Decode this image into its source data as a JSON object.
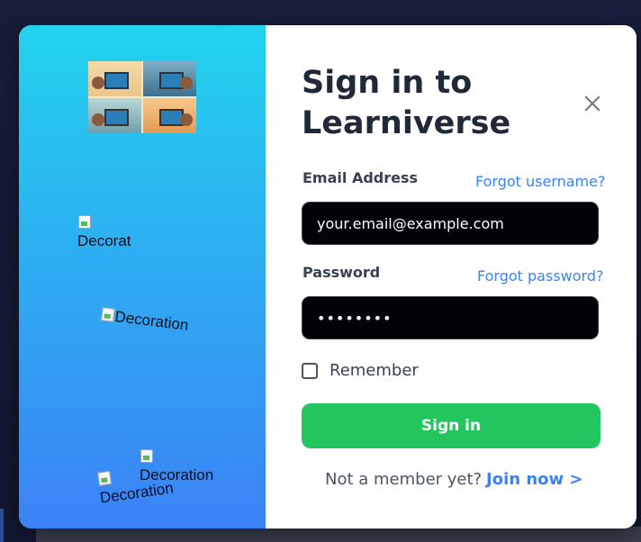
{
  "decoration_alt": "Decoration",
  "modal": {
    "title_line1": "Sign in to",
    "title_line2": "Learniverse",
    "email_label": "Email Address",
    "forgot_username": "Forgot username?",
    "email_value": "your.email@example.com",
    "password_label": "Password",
    "forgot_password": "Forgot password?",
    "password_value": "••••••••",
    "remember_label": "Remember",
    "sign_in_button": "Sign in",
    "not_member": "Not a member yet?",
    "join_now": "Join now >"
  },
  "icons": {
    "close": "close-icon",
    "logo": "learning-illustration-logo",
    "broken_image": "broken-image-icon"
  },
  "colors": {
    "gradient_top": "#22d3ee",
    "gradient_bottom": "#3b82f6",
    "accent_link": "#3b82f6",
    "button_green": "#22c55e",
    "input_bg": "#020308"
  }
}
